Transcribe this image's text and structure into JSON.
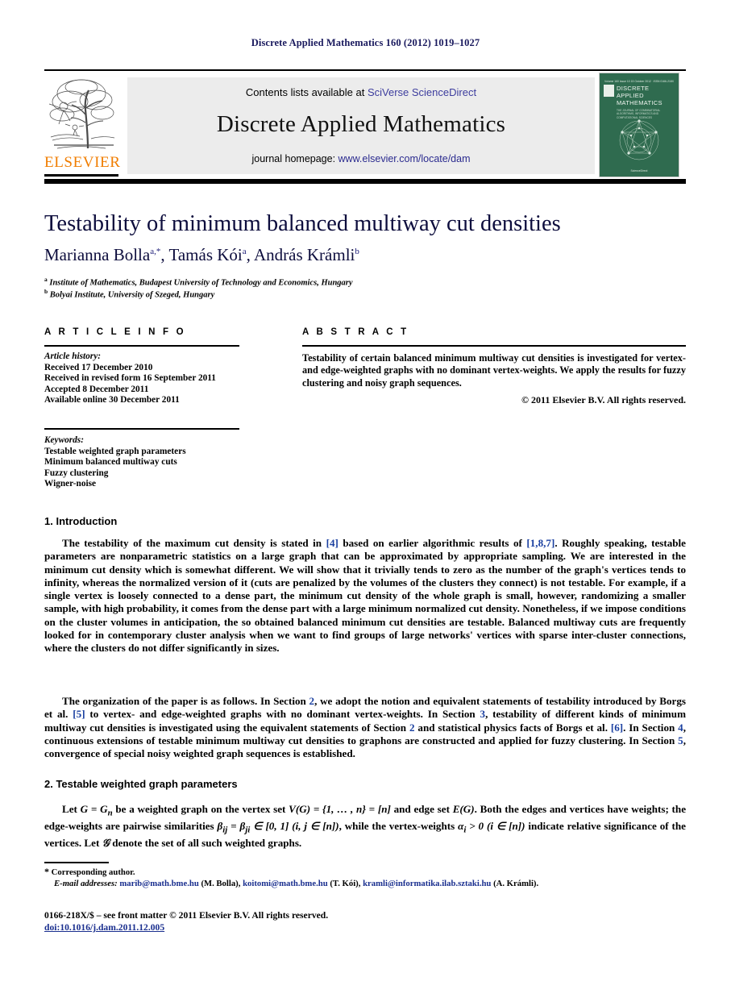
{
  "running_head": "Discrete Applied Mathematics 160 (2012) 1019–1027",
  "masthead": {
    "contents_prefix": "Contents lists available at ",
    "sciencedirect": "SciVerse ScienceDirect",
    "journal_title": "Discrete Applied Mathematics",
    "homepage_prefix": "journal homepage: ",
    "homepage_url": "www.elsevier.com/locate/dam",
    "publisher_wordmark": "ELSEVIER",
    "cover": {
      "volume_line": "Volume 160  Issue 10  15 October 2012",
      "issn_line": "ISSN 0166-218X",
      "title_lines": [
        "DISCRETE",
        "APPLIED",
        "MATHEMATICS"
      ],
      "subtitle": "THE JOURNAL OF COMBINATORIAL ALGORITHMS, INFORMATICS AND COMPUTATIONAL SCIENCES",
      "footer": "ScienceDirect"
    }
  },
  "article": {
    "title": "Testability of minimum balanced multiway cut densities",
    "authors": [
      {
        "name": "Marianna Bolla",
        "marks": "a,*"
      },
      {
        "name": "Tamás Kói",
        "marks": "a"
      },
      {
        "name": "András Krámli",
        "marks": "b"
      }
    ],
    "authors_joined": "Marianna Bolla, Tamás Kói, András Krámli",
    "affiliations": [
      {
        "mark": "a",
        "text": "Institute of Mathematics, Budapest University of Technology and Economics, Hungary"
      },
      {
        "mark": "b",
        "text": "Bolyai Institute, University of Szeged, Hungary"
      }
    ]
  },
  "info": {
    "heading": "A R T I C L E   I N F O",
    "history_label": "Article history:",
    "history": [
      "Received 17 December 2010",
      "Received in revised form 16 September 2011",
      "Accepted 8 December 2011",
      "Available online 30 December 2011"
    ],
    "keywords_label": "Keywords:",
    "keywords": [
      "Testable weighted graph parameters",
      "Minimum balanced multiway cuts",
      "Fuzzy clustering",
      "Wigner-noise"
    ]
  },
  "abstract": {
    "heading": "A B S T R A C T",
    "text": "Testability of certain balanced minimum multiway cut densities is investigated for vertex- and edge-weighted graphs with no dominant vertex-weights. We apply the results for fuzzy clustering and noisy graph sequences.",
    "copyright": "© 2011 Elsevier B.V. All rights reserved."
  },
  "sections": {
    "intro_heading": "1. Introduction",
    "sec2_heading": "2. Testable weighted graph parameters"
  },
  "paragraphs": {
    "p1_a": "The testability of the maximum cut density is stated in ",
    "p1_ref1": "[4]",
    "p1_b": " based on earlier algorithmic results of ",
    "p1_ref2": "[1,8,7]",
    "p1_c": ". Roughly speaking, testable parameters are nonparametric statistics on a large graph that can be approximated by appropriate sampling. We are interested in the minimum cut density which is somewhat different. We will show that it trivially tends to zero as the number of the graph's vertices tends to infinity, whereas the normalized version of it (cuts are penalized by the volumes of the clusters they connect) is not testable. For example, if a single vertex is loosely connected to a dense part, the minimum cut density of the whole graph is small, however, randomizing a smaller sample, with high probability, it comes from the dense part with a large minimum normalized cut density. Nonetheless, if we impose conditions on the cluster volumes in anticipation, the so obtained balanced minimum cut densities are testable. Balanced multiway cuts are frequently looked for in contemporary cluster analysis when we want to find groups of large networks' vertices with sparse inter-cluster connections, where the clusters do not differ significantly in sizes.",
    "p2_a": "The organization of the paper is as follows. In Section ",
    "p2_s2": "2",
    "p2_b": ", we adopt the notion and equivalent statements of testability introduced by Borgs et al. ",
    "p2_ref5": "[5]",
    "p2_c": " to vertex- and edge-weighted graphs with no dominant vertex-weights. In Section ",
    "p2_s3": "3",
    "p2_d": ", testability of different kinds of minimum multiway cut densities is investigated using the equivalent statements of Section ",
    "p2_s2b": "2",
    "p2_e": " and statistical physics facts of Borgs et al. ",
    "p2_ref6": "[6]",
    "p2_f": ". In Section ",
    "p2_s4": "4",
    "p2_g": ", continuous extensions of testable minimum multiway cut densities to graphons are constructed and applied for fuzzy clustering. In Section ",
    "p2_s5": "5",
    "p2_h": ", convergence of special noisy weighted graph sequences is established.",
    "p3_a": "Let ",
    "p3_math1": "G = G",
    "p3_sub1": "n",
    "p3_b": " be a weighted graph on the vertex set ",
    "p3_math2": "V(G) = {1, … , n} = [n]",
    "p3_c": " and edge set ",
    "p3_math3": "E(G)",
    "p3_d": ". Both the edges and vertices have weights; the edge-weights are pairwise similarities ",
    "p3_math4": "β",
    "p3_sub4": "ij",
    "p3_math5": " = β",
    "p3_sub5": "ji",
    "p3_math6": " ∈ [0, 1] (i, j ∈ [n])",
    "p3_e": ", while the vertex-weights ",
    "p3_math7": "α",
    "p3_sub7": "i",
    "p3_math8": " > 0 (i ∈ [n])",
    "p3_f": " indicate relative significance of the vertices. Let ",
    "p3_math9": "𝒢",
    "p3_g": " denote the set of all such weighted graphs."
  },
  "footnote": {
    "star": "*",
    "corresponding": " Corresponding author.",
    "emails_label": "E-mail addresses:",
    "emails": [
      {
        "address": "marib@math.bme.hu",
        "owner": " (M. Bolla), "
      },
      {
        "address": "koitomi@math.bme.hu",
        "owner": " (T. Kói), "
      },
      {
        "address": "kramli@informatika.ilab.sztaki.hu",
        "owner": " (A. Krámli)."
      }
    ]
  },
  "imprint": {
    "line1": "0166-218X/$ – see front matter © 2011 Elsevier B.V. All rights reserved.",
    "doi": "doi:10.1016/j.dam.2011.12.005"
  },
  "colors": {
    "heading_navy": "#1a1a5e",
    "link_blue": "#1a3fa0",
    "elsevier_orange": "#f07d00",
    "cover_green": "#2f6b4f",
    "band_gray": "#ececec"
  }
}
